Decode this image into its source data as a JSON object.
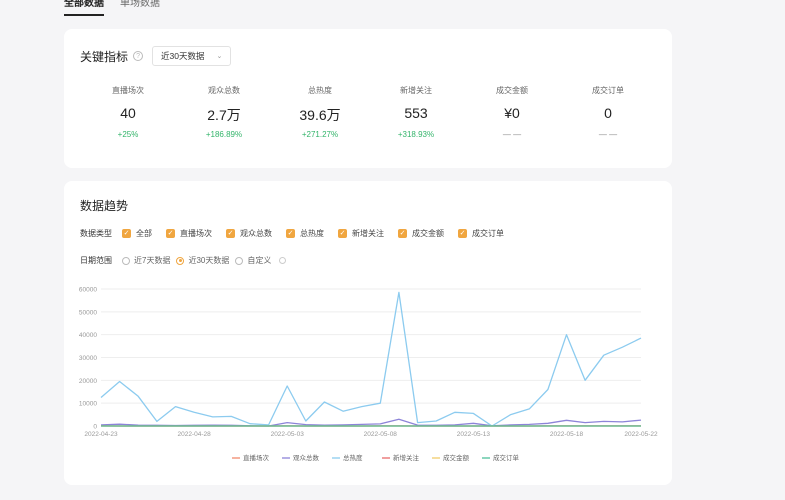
{
  "tabs": [
    {
      "label": "全部数据",
      "active": true
    },
    {
      "label": "单场数据",
      "active": false
    }
  ],
  "kpi_section": {
    "title": "关键指标",
    "range_select": "近30天数据",
    "items": [
      {
        "label": "直播场次",
        "value": "40",
        "change": "+25%",
        "trend": "up"
      },
      {
        "label": "观众总数",
        "value": "2.7万",
        "change": "+186.89%",
        "trend": "up"
      },
      {
        "label": "总热度",
        "value": "39.6万",
        "change": "+271.27%",
        "trend": "up"
      },
      {
        "label": "新增关注",
        "value": "553",
        "change": "+318.93%",
        "trend": "up"
      },
      {
        "label": "成交金额",
        "value": "¥0",
        "change": "— —",
        "trend": "none"
      },
      {
        "label": "成交订单",
        "value": "0",
        "change": "— —",
        "trend": "none"
      }
    ]
  },
  "trend_section": {
    "title": "数据趋势",
    "type_label": "数据类型",
    "types": [
      "全部",
      "直播场次",
      "观众总数",
      "总热度",
      "新增关注",
      "成交金额",
      "成交订单"
    ],
    "date_label": "日期范围",
    "date_options": [
      {
        "label": "近7天数据",
        "selected": false
      },
      {
        "label": "近30天数据",
        "selected": true
      },
      {
        "label": "自定义",
        "selected": false
      }
    ]
  },
  "colors": {
    "accent": "#f0a640",
    "positive": "#33b46a"
  },
  "chart_data": {
    "type": "line",
    "ylim": [
      0,
      60000
    ],
    "yticks": [
      "0",
      "10000",
      "20000",
      "30000",
      "40000",
      "50000",
      "60000"
    ],
    "x": [
      "2022-04-23",
      "2022-04-24",
      "2022-04-25",
      "2022-04-26",
      "2022-04-27",
      "2022-04-28",
      "2022-04-29",
      "2022-04-30",
      "2022-05-01",
      "2022-05-02",
      "2022-05-03",
      "2022-05-04",
      "2022-05-05",
      "2022-05-06",
      "2022-05-07",
      "2022-05-08",
      "2022-05-09",
      "2022-05-10",
      "2022-05-11",
      "2022-05-12",
      "2022-05-13",
      "2022-05-14",
      "2022-05-15",
      "2022-05-16",
      "2022-05-17",
      "2022-05-18",
      "2022-05-19",
      "2022-05-20",
      "2022-05-21",
      "2022-05-22"
    ],
    "xtick_labels": [
      "2022-04-23",
      "2022-04-28",
      "2022-05-03",
      "2022-05-08",
      "2022-05-13",
      "2022-05-18",
      "2022-05-22"
    ],
    "legend_position": "bottom",
    "series": [
      {
        "name": "直播场次",
        "color": "#f08a6c",
        "values": [
          2,
          1,
          1,
          1,
          0,
          1,
          1,
          2,
          0,
          0,
          2,
          1,
          1,
          1,
          2,
          2,
          1,
          2,
          1,
          2,
          0,
          2,
          2,
          2,
          2,
          2,
          1,
          2,
          2,
          1
        ]
      },
      {
        "name": "观众总数",
        "color": "#8d84d8",
        "values": [
          500,
          800,
          400,
          300,
          200,
          300,
          400,
          300,
          100,
          0,
          1500,
          600,
          400,
          500,
          700,
          900,
          3000,
          400,
          300,
          500,
          1200,
          100,
          500,
          700,
          1200,
          2500,
          1500,
          2000,
          1800,
          2600
        ]
      },
      {
        "name": "总热度",
        "color": "#8ccbef",
        "values": [
          12500,
          19500,
          13000,
          2000,
          8500,
          6000,
          4000,
          4200,
          1000,
          500,
          17500,
          2200,
          10500,
          6500,
          8500,
          10000,
          58500,
          1500,
          2200,
          6000,
          5500,
          0,
          5000,
          7500,
          16000,
          40000,
          20000,
          31000,
          34500,
          38500
        ]
      },
      {
        "name": "新增关注",
        "color": "#e86b6b",
        "values": [
          30,
          20,
          10,
          5,
          8,
          10,
          12,
          10,
          2,
          0,
          40,
          15,
          20,
          18,
          20,
          25,
          60,
          10,
          8,
          15,
          20,
          0,
          15,
          20,
          30,
          50,
          30,
          40,
          45,
          50
        ]
      },
      {
        "name": "成交金额",
        "color": "#f2cd6b",
        "values": [
          0,
          0,
          0,
          0,
          0,
          0,
          0,
          0,
          0,
          0,
          0,
          0,
          0,
          0,
          0,
          0,
          0,
          0,
          0,
          0,
          0,
          0,
          0,
          0,
          0,
          0,
          0,
          0,
          0,
          0
        ]
      },
      {
        "name": "成交订单",
        "color": "#4fbf9c",
        "values": [
          0,
          0,
          0,
          0,
          0,
          0,
          0,
          0,
          0,
          0,
          0,
          0,
          0,
          0,
          0,
          0,
          0,
          0,
          0,
          0,
          0,
          0,
          0,
          0,
          0,
          0,
          0,
          0,
          0,
          0
        ]
      }
    ]
  }
}
